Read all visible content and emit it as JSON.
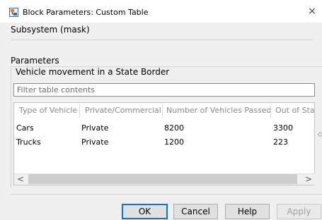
{
  "window": {
    "title": "Block Parameters: Custom Table",
    "close_glyph": "×"
  },
  "dialog": {
    "subsystem_label": "Subsystem (mask)",
    "parameters_label": "Parameters"
  },
  "table_group": {
    "label": "Vehicle movement in a State Border",
    "filter_placeholder": "Filter table contents",
    "columns": [
      "Type of Vehicle",
      "Private/Commercial",
      "Number of Vehicles Passed",
      "Out of Sta"
    ],
    "rows": [
      [
        "Cars",
        "Private",
        "8200",
        "3300"
      ],
      [
        "Trucks",
        "Private",
        "1200",
        "223"
      ]
    ],
    "scroll_left_glyph": "<",
    "scroll_right_glyph": ">",
    "resize_glyph": "◇"
  },
  "buttons": {
    "ok": "OK",
    "cancel": "Cancel",
    "help": "Help",
    "apply": "Apply"
  },
  "icons": {
    "app": "simulink-block-icon",
    "close": "close-icon"
  }
}
